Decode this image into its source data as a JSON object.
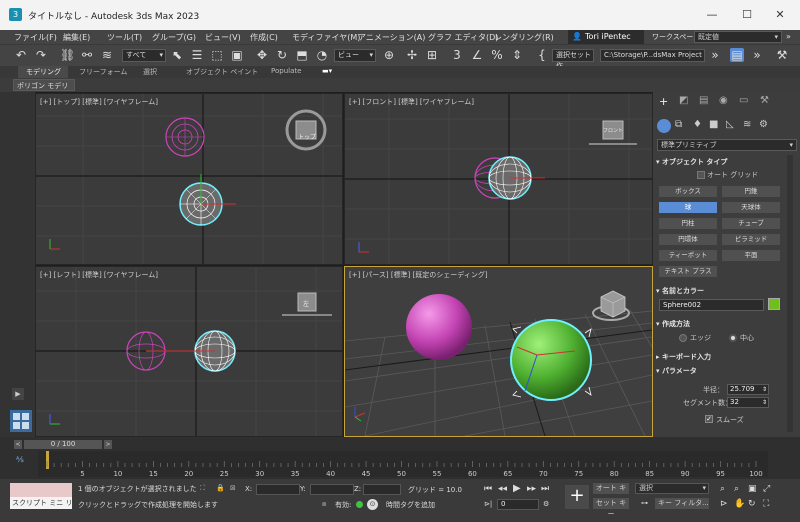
{
  "window": {
    "title": "タイトルなし - Autodesk 3ds Max 2023",
    "app_icon": "3ds-max-icon",
    "controls": [
      "minimize-icon",
      "maximize-icon",
      "close-icon"
    ]
  },
  "menu": {
    "items": [
      "ファイル(F)",
      "編集(E)",
      "ツール(T)",
      "グループ(G)",
      "ビュー(V)",
      "作成(C)",
      "モディファイヤ(M)",
      "アニメーション(A)",
      "グラフ エディタ(D)",
      "レンダリング(R)"
    ],
    "user": "Tori iPentec",
    "workspace_label": "ワークスペース:",
    "workspace_value": "既定値"
  },
  "toolbar": {
    "selection_filter": "すべて",
    "reference_coord": "ビュー",
    "named_selection": "選択セット作",
    "project_path": "C:\\Storage\\P...dsMax Project"
  },
  "ribbon": {
    "tabs": [
      "モデリング",
      "フリーフォーム",
      "選択",
      "オブジェクト ペイント",
      "Populate"
    ],
    "sub_tab": "ポリゴン モデリング"
  },
  "viewports": {
    "top": "[+] [トップ] [標準] [ワイヤフレーム]",
    "front": "[+] [フロント] [標準] [ワイヤフレーム]",
    "left": "[+] [レフト] [標準] [ワイヤフレーム]",
    "perspective": "[+] [パース] [標準] [既定のシェーディング]",
    "viewcube_top": "トップ",
    "viewcube_front": "フロント",
    "viewcube_left": "左"
  },
  "command_panel": {
    "category": "標準プリミティブ",
    "object_type_header": "オブジェクト タイプ",
    "autogrid_label": "オート グリッド",
    "buttons": [
      "ボックス",
      "円錐",
      "球",
      "天球体",
      "円柱",
      "チューブ",
      "円環体",
      "ピラミッド",
      "ティーポット",
      "平面",
      "テキスト プラス"
    ],
    "name_color_header": "名前とカラー",
    "object_name": "Sphere002",
    "object_color": "#6fbf1f",
    "creation_method_header": "作成方法",
    "edge_label": "エッジ",
    "center_label": "中心",
    "keyboard_entry_header": "キーボード入力",
    "parameters_header": "パラメータ",
    "radius_label": "半径：",
    "radius_value": "25.709",
    "segments_label": "セグメント数：",
    "segments_value": "32",
    "smooth_label": "スムーズ"
  },
  "timeline": {
    "frame_display": "0 / 100",
    "ticks": [
      "0",
      "5",
      "10",
      "15",
      "20",
      "25",
      "30",
      "35",
      "40",
      "45",
      "50",
      "55",
      "60",
      "65",
      "70",
      "75",
      "80",
      "85",
      "90",
      "95",
      "100"
    ]
  },
  "status": {
    "script_label": "スクリプト ミニ リス",
    "selection_msg": "1 個のオブジェクトが選択されました",
    "prompt_msg": "クリックとドラッグで作成処理を開始します",
    "x_label": "X:",
    "y_label": "Y:",
    "z_label": "Z:",
    "grid_label": "グリッド = 10.0",
    "enabled_label": "有効:",
    "time_tag": "時間タグを追加",
    "frame_value": "0",
    "auto_key": "オート キー",
    "set_key": "セット キー",
    "selection_dropdown": "選択",
    "key_filter": "キー フィルタ..."
  },
  "colors": {
    "accent": "#5b8dd6",
    "magenta_sphere": "#cc44bb",
    "selected_wire": "#6ff0ff",
    "green_sphere": "#5ab83a",
    "active_border": "#c9a43a"
  }
}
